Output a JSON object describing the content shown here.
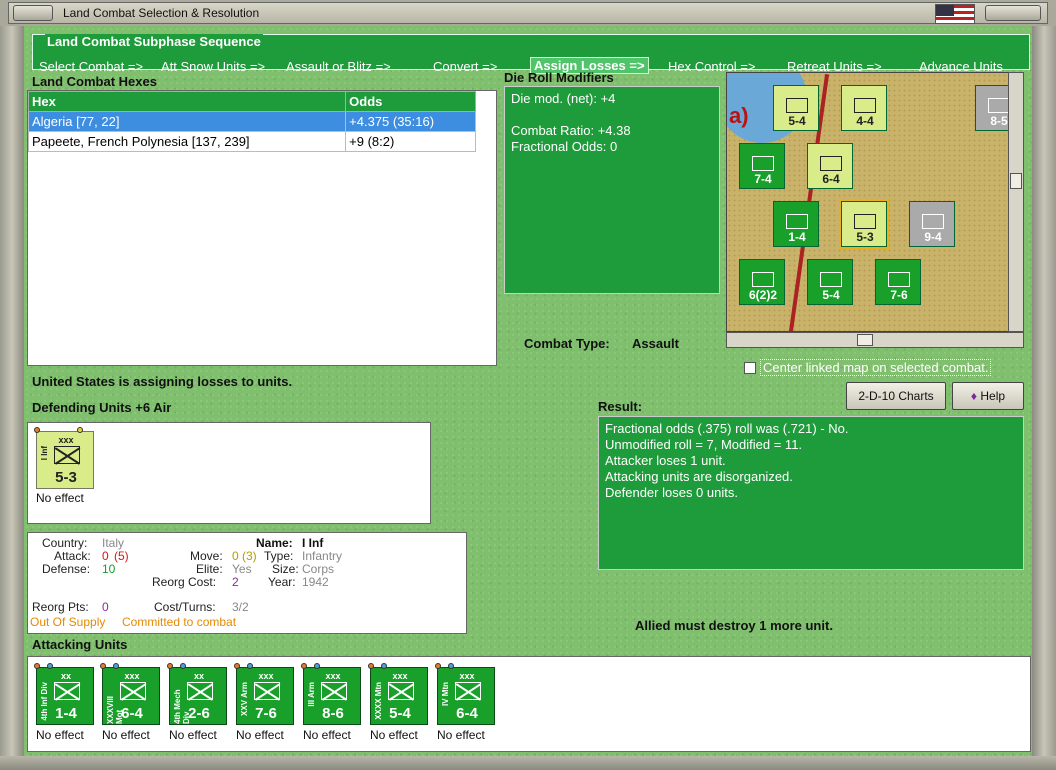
{
  "window": {
    "title": "Land Combat Selection & Resolution"
  },
  "sequence": {
    "title": "Land Combat Subphase Sequence",
    "steps": [
      "Select Combat =>",
      "Att Snow Units =>",
      "Assault or Blitz =>",
      "Convert =>",
      "Assign Losses =>",
      "Hex Control =>",
      "Retreat Units =>",
      "Advance Units"
    ],
    "active_index": 4
  },
  "hexes": {
    "title": "Land Combat Hexes",
    "headers": [
      "Hex",
      "Odds"
    ],
    "rows": [
      {
        "hex": "Algeria [77, 22]",
        "odds": "+4.375 (35:16)"
      },
      {
        "hex": "Papeete, French Polynesia [137, 239]",
        "odds": "+9 (8:2)"
      }
    ],
    "selected": 0
  },
  "modifiers": {
    "title": "Die Roll Modifiers",
    "lines": [
      "Die mod. (net): +4",
      "",
      "Combat Ratio: +4.38",
      "Fractional Odds: 0"
    ]
  },
  "combat_type": {
    "label": "Combat Type:",
    "value": "Assault"
  },
  "center_linked": {
    "label": "Center linked map on selected combat.",
    "checked": false
  },
  "buttons": {
    "charts": "2-D-10 Charts",
    "help": "Help"
  },
  "status": "United States is assigning losses to units.",
  "defending": {
    "title": "Defending Units +6 Air",
    "units": [
      {
        "size": "xxx",
        "name": "I Inf",
        "stats": "5-3",
        "result": "No effect"
      }
    ]
  },
  "result": {
    "title": "Result:",
    "lines": [
      "Fractional odds (.375) roll was (.721)  - No.",
      "Unmodified roll = 7, Modified = 11.",
      "Attacker loses 1 unit.",
      "Attacking units are disorganized.",
      "Defender loses 0 units."
    ]
  },
  "details": {
    "country_label": "Country:",
    "country": "Italy",
    "attack_label": "Attack:",
    "attack": "0",
    "attack_base": "(5)",
    "defense_label": "Defense:",
    "defense": "10",
    "name_label": "Name:",
    "name": "I Inf",
    "move_label": "Move:",
    "move": "0",
    "move_base": "(3)",
    "type_label": "Type:",
    "type": "Infantry",
    "elite_label": "Elite:",
    "elite": "Yes",
    "size_label": "Size:",
    "size": "Corps",
    "reorg_cost_label": "Reorg Cost:",
    "reorg_cost": "2",
    "year_label": "Year:",
    "year": "1942",
    "reorg_pts_label": "Reorg Pts:",
    "reorg_pts": "0",
    "cost_turns_label": "Cost/Turns:",
    "cost_turns": "3/2",
    "supply": "Out Of Supply",
    "committed": "Committed to combat"
  },
  "must_destroy": "Allied must destroy 1 more unit.",
  "attacking": {
    "title": "Attacking Units",
    "units": [
      {
        "size": "xx",
        "name": "4th Inf Div",
        "stats": "1-4",
        "result": "No effect"
      },
      {
        "size": "xxx",
        "name": "XXXVIII Mot",
        "stats": "6-4",
        "result": "No effect"
      },
      {
        "size": "xx",
        "name": "4th Mech Div",
        "stats": "2-6",
        "result": "No effect"
      },
      {
        "size": "xxx",
        "name": "XXV Arm",
        "stats": "7-6",
        "result": "No effect"
      },
      {
        "size": "xxx",
        "name": "III Arm",
        "stats": "8-6",
        "result": "No effect"
      },
      {
        "size": "xxx",
        "name": "XXXX Mtn",
        "stats": "5-4",
        "result": "No effect"
      },
      {
        "size": "xxx",
        "name": "IV Mtn",
        "stats": "6-4",
        "result": "No effect"
      }
    ]
  },
  "map": {
    "units": [
      {
        "stats": "5-4",
        "color": "yel"
      },
      {
        "stats": "4-4",
        "color": "yel"
      },
      {
        "stats": "8-5",
        "color": "gry"
      },
      {
        "stats": "7-4",
        "color": "grn"
      },
      {
        "stats": "6-4",
        "color": "yel"
      },
      {
        "stats": "1-4",
        "color": "grn"
      },
      {
        "stats": "5-3",
        "color": "yel"
      },
      {
        "stats": "9-4",
        "color": "gry"
      },
      {
        "stats": "6(2)2",
        "color": "grn"
      },
      {
        "stats": "5-4",
        "color": "grn"
      },
      {
        "stats": "7-6",
        "color": "grn"
      }
    ],
    "label": "a)"
  }
}
